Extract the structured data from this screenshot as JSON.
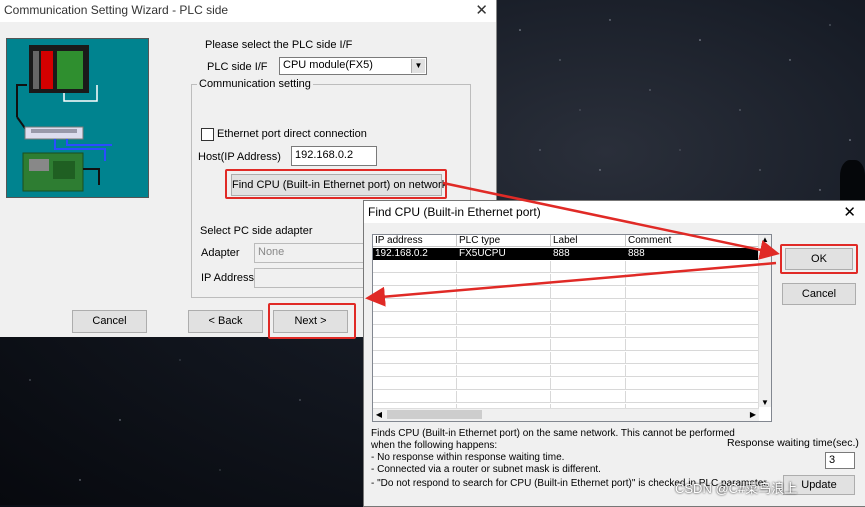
{
  "wizard": {
    "title": "Communication Setting Wizard - PLC side",
    "close_glyph": "✕",
    "prompt": "Please select the PLC side I/F",
    "plc_side_if_label": "PLC side I/F",
    "plc_side_if_value": "CPU module(FX5)",
    "comm_group_label": "Communication setting",
    "ethernet_direct_label": "Ethernet port direct connection",
    "ethernet_direct_checked": false,
    "host_label": "Host(IP Address)",
    "host_value": "192.168.0.2",
    "find_cpu_button": "Find CPU (Built-in Ethernet port) on network",
    "pc_adapter_label": "Select PC side adapter",
    "adapter_label": "Adapter",
    "adapter_value": "None",
    "ip_address_label": "IP Address",
    "cancel_button": "Cancel",
    "back_button": "< Back",
    "next_button": "Next >"
  },
  "find_dialog": {
    "title": "Find CPU (Built-in Ethernet port)",
    "close_glyph": "✕",
    "columns": [
      "IP address",
      "PLC type",
      "Label",
      "Comment"
    ],
    "rows": [
      {
        "ip": "192.168.0.2",
        "plc_type": "FX5UCPU",
        "label": "888",
        "comment": "888"
      }
    ],
    "ok_button": "OK",
    "cancel_button": "Cancel",
    "info_lines": [
      "Finds CPU (Built-in Ethernet port) on the same network. This cannot be performed",
      "when the following happens:",
      "- No response within response waiting time.",
      "- Connected via a router or subnet mask is different.",
      "- \"Do not respond to search for CPU (Built-in Ethernet port)\" is checked in PLC parameter."
    ],
    "response_label": "Response waiting time(sec.)",
    "response_value": "3",
    "update_button": "Update"
  },
  "watermark": "CSDN @C#菜鸟浪上",
  "colors": {
    "highlight_red": "#e02a26",
    "selected_row": "#000000",
    "diagram_bg": "#00838f"
  }
}
